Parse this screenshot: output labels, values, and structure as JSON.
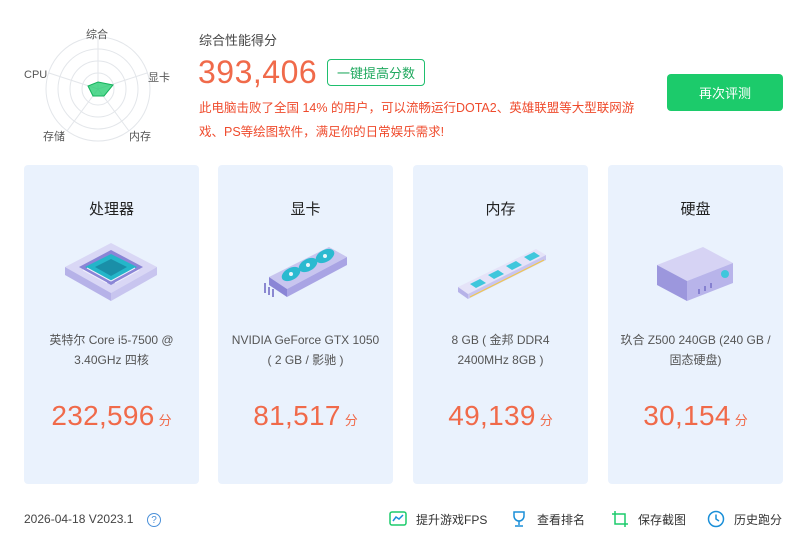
{
  "radar": {
    "labels": {
      "top": "综合",
      "right": "显卡",
      "bottom_right": "内存",
      "bottom_left": "存储",
      "left": "CPU"
    }
  },
  "summary": {
    "title": "综合性能得分",
    "score": "393,406",
    "boost_label": "一键提高分数",
    "description": "此电脑击败了全国 14% 的用户，可以流畅运行DOTA2、英雄联盟等大型联网游戏、PS等绘图软件，满足你的日常娱乐需求!",
    "retest_label": "再次评测"
  },
  "cards": [
    {
      "title": "处理器",
      "desc": "英特尔 Core i5-7500 @ 3.40GHz 四核",
      "score": "232,596",
      "unit": "分",
      "icon": "cpu-chip-icon"
    },
    {
      "title": "显卡",
      "desc": "NVIDIA GeForce GTX 1050 ( 2 GB / 影驰 )",
      "score": "81,517",
      "unit": "分",
      "icon": "graphics-card-icon"
    },
    {
      "title": "内存",
      "desc": "8 GB ( 金邦 DDR4 2400MHz 8GB )",
      "score": "49,139",
      "unit": "分",
      "icon": "memory-stick-icon"
    },
    {
      "title": "硬盘",
      "desc": "玖合 Z500 240GB (240 GB / 固态硬盘)",
      "score": "30,154",
      "unit": "分",
      "icon": "hard-disk-icon"
    }
  ],
  "footer": {
    "version": "2026-04-18 V2023.1",
    "help": "?",
    "fps_label": "提升游戏FPS",
    "rank_label": "查看排名",
    "screenshot_label": "保存截图",
    "history_label": "历史跑分"
  },
  "colors": {
    "accent_green": "#1ccb6b",
    "score_orange": "#f06a4a",
    "card_bg": "#eaf2fd"
  }
}
